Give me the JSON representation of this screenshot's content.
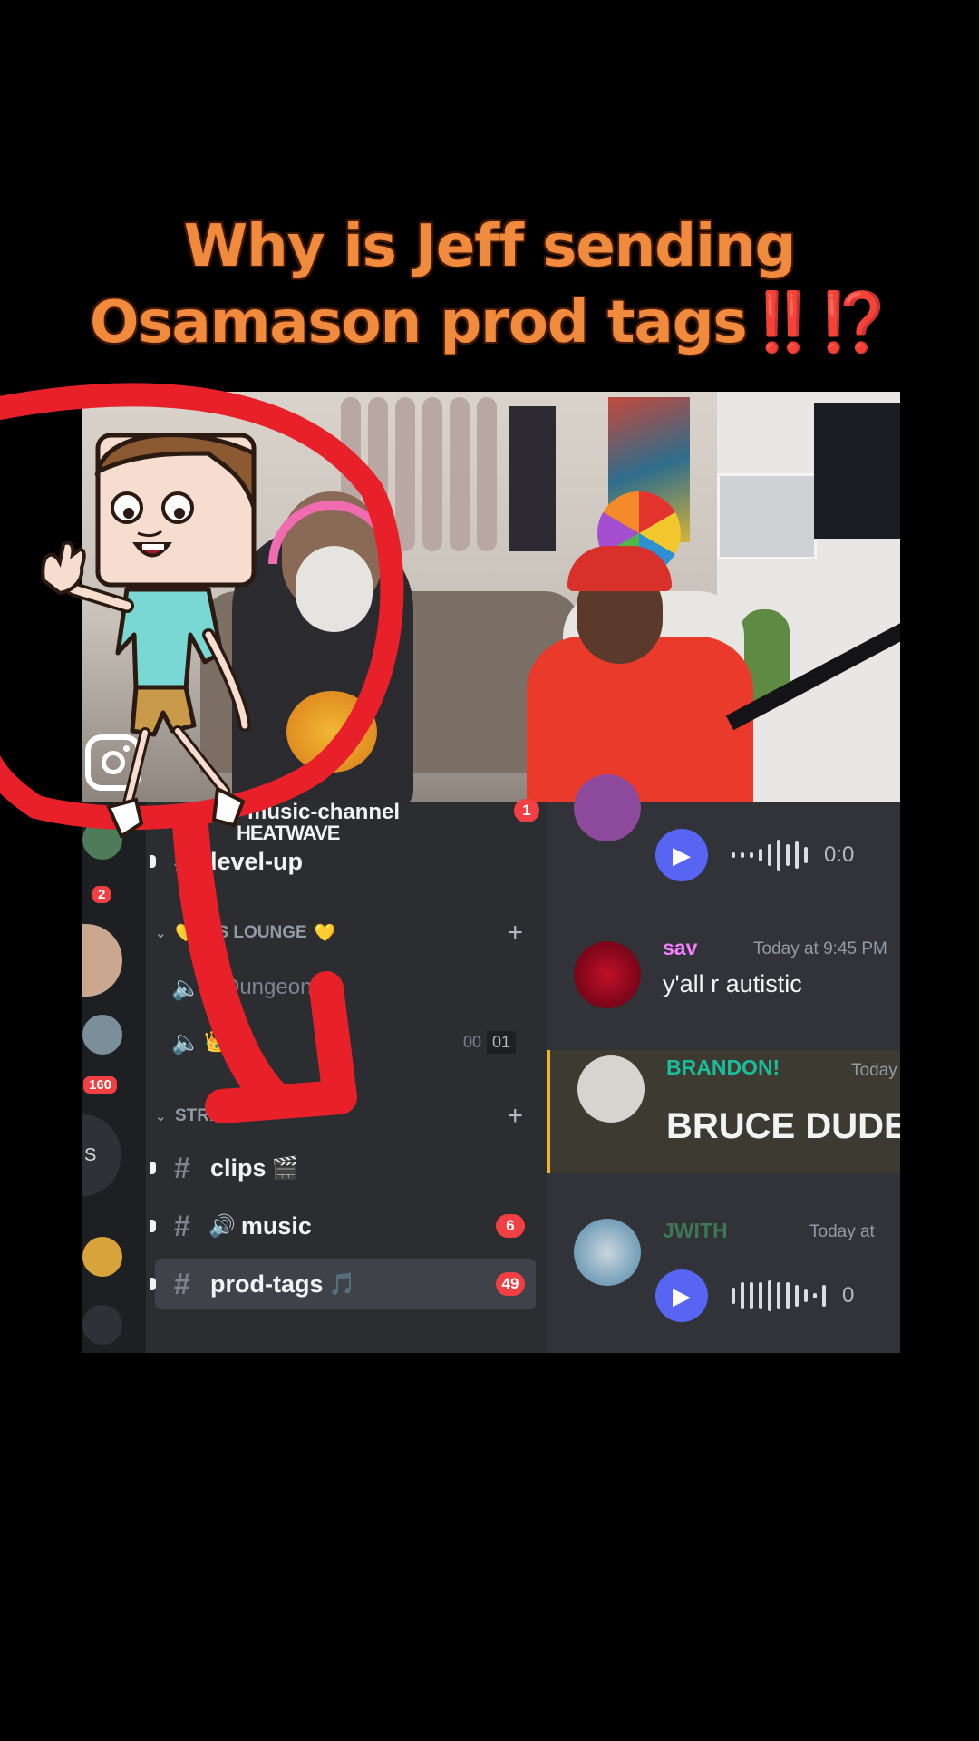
{
  "caption": {
    "line1": "Why is Jeff sending",
    "line2": "Osamason prod tags",
    "alarm": "‼️⁉️"
  },
  "guild_badges": {
    "top": "2",
    "bottom": "160"
  },
  "guild_letter": "S",
  "overlay": {
    "channel_top": "music-channel",
    "heatwave": "HEATWAVE",
    "channel_top_badge": "1"
  },
  "channels": {
    "level_up": "level-up",
    "lounge_category": "GS LOUNGE",
    "lounge_heart": "💛",
    "voice1": "Dungeon",
    "voice2_suffix": "O",
    "voice2_counts": [
      "00",
      "01"
    ],
    "stream_category": "STREAM",
    "items": [
      {
        "label": "clips",
        "emoji": "🎬",
        "badge": ""
      },
      {
        "label": "music",
        "emoji": "🔊",
        "badge": "6",
        "prefix_emoji": "🔊"
      },
      {
        "label": "prod-tags",
        "emoji": "🎵",
        "badge": "49"
      }
    ]
  },
  "chat": {
    "audio_top_time": "0:0",
    "messages": [
      {
        "name": "sav",
        "time": "Today at 9:45 PM",
        "text": "y'all r autistic",
        "name_color": "#f47fff"
      },
      {
        "name": "BRANDON!",
        "time": "Today",
        "text": "BRUCE DUDE",
        "name_color": "#1abc9c"
      },
      {
        "name": "JWITH",
        "time": "Today at",
        "text": "",
        "name_color": "#57f287"
      }
    ],
    "audio_bottom_time": "0"
  },
  "colors": {
    "caption": "#f08a3c",
    "alarm": "#e8211a",
    "annotation_red": "#e8202a",
    "discord_blurple": "#5865f2",
    "badge_red": "#f23f43"
  }
}
